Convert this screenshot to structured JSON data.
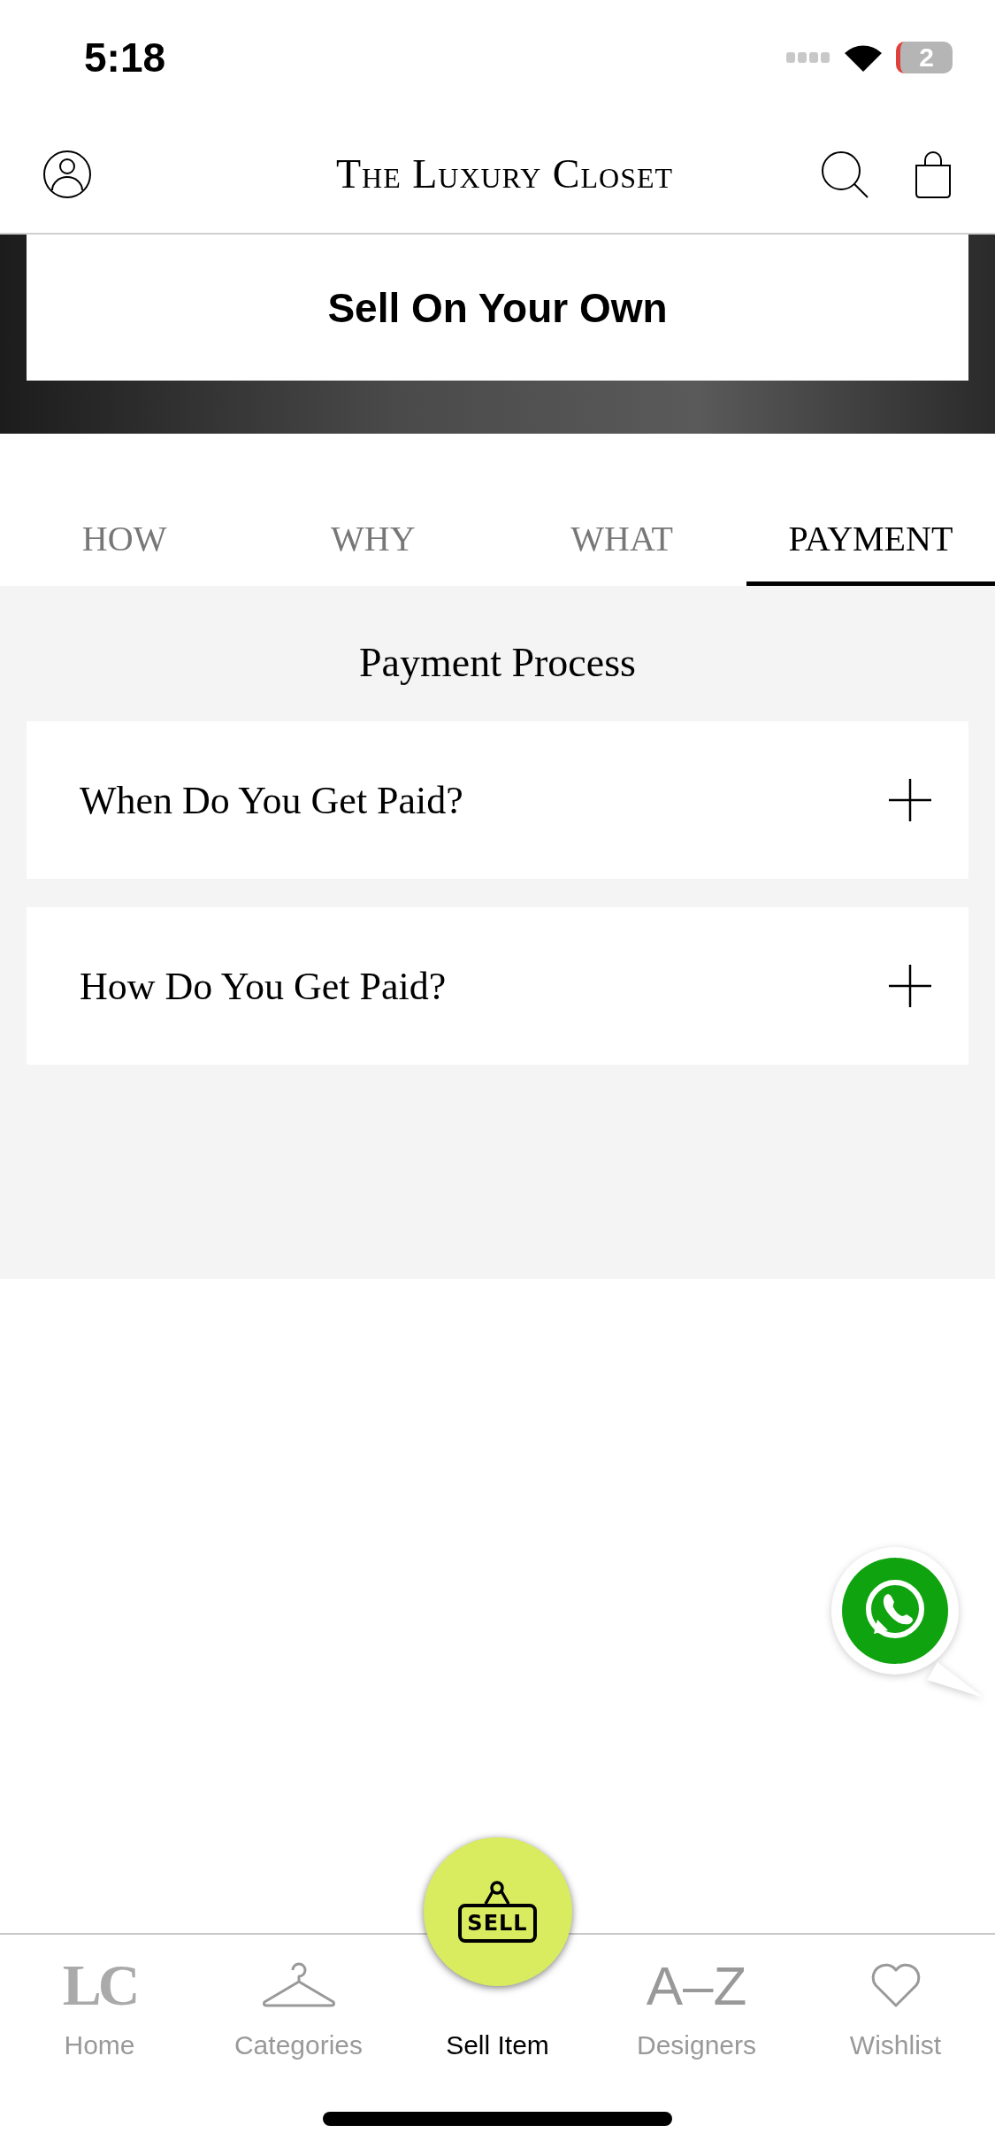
{
  "status_bar": {
    "time": "5:18",
    "battery": "2"
  },
  "header": {
    "logo": "The Luxury Closet"
  },
  "hero": {
    "button": "Sell On Your Own"
  },
  "tabs": [
    {
      "label": "HOW",
      "selected": false
    },
    {
      "label": "WHY",
      "selected": false
    },
    {
      "label": "WHAT",
      "selected": false
    },
    {
      "label": "PAYMENT",
      "selected": true
    }
  ],
  "section_title": "Payment Process",
  "accordion": [
    {
      "title": "When Do You Get Paid?",
      "expanded": false
    },
    {
      "title": "How Do You Get Paid?",
      "expanded": false
    }
  ],
  "bottom_nav": [
    {
      "kind": "monogram",
      "glyph": "LC",
      "label": "Home",
      "selected": false
    },
    {
      "kind": "hanger",
      "label": "Categories",
      "selected": false
    },
    {
      "kind": "sell",
      "glyph": "SELL",
      "label": "Sell Item",
      "selected": true
    },
    {
      "kind": "letters",
      "glyph": "A–Z",
      "label": "Designers",
      "selected": false
    },
    {
      "kind": "heart",
      "label": "Wishlist",
      "selected": false
    }
  ]
}
